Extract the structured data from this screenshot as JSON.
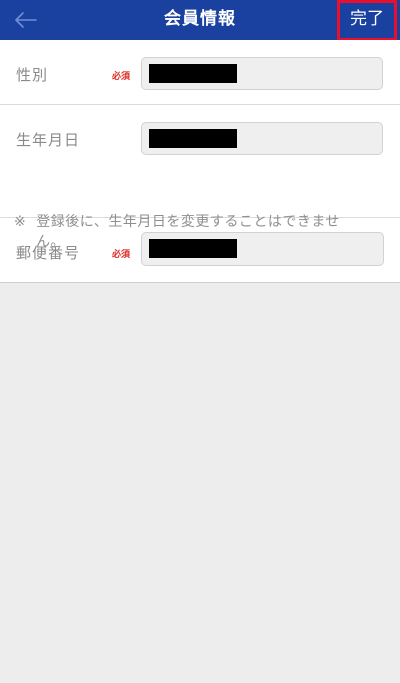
{
  "header": {
    "title": "会員情報",
    "back_icon": "arrow-left-icon",
    "done_label": "完了"
  },
  "form": {
    "gender": {
      "label": "性別",
      "required": "必須"
    },
    "birthdate": {
      "label": "生年月日"
    },
    "note": {
      "mark": "※",
      "line1": "登録後に、生年月日を変更することはできませ",
      "line2": "ん。"
    },
    "postal": {
      "label": "郵便番号",
      "required": "必須"
    }
  },
  "colors": {
    "navbar": "#1a41a0",
    "required": "#e0281f",
    "highlight": "#e8102c"
  }
}
